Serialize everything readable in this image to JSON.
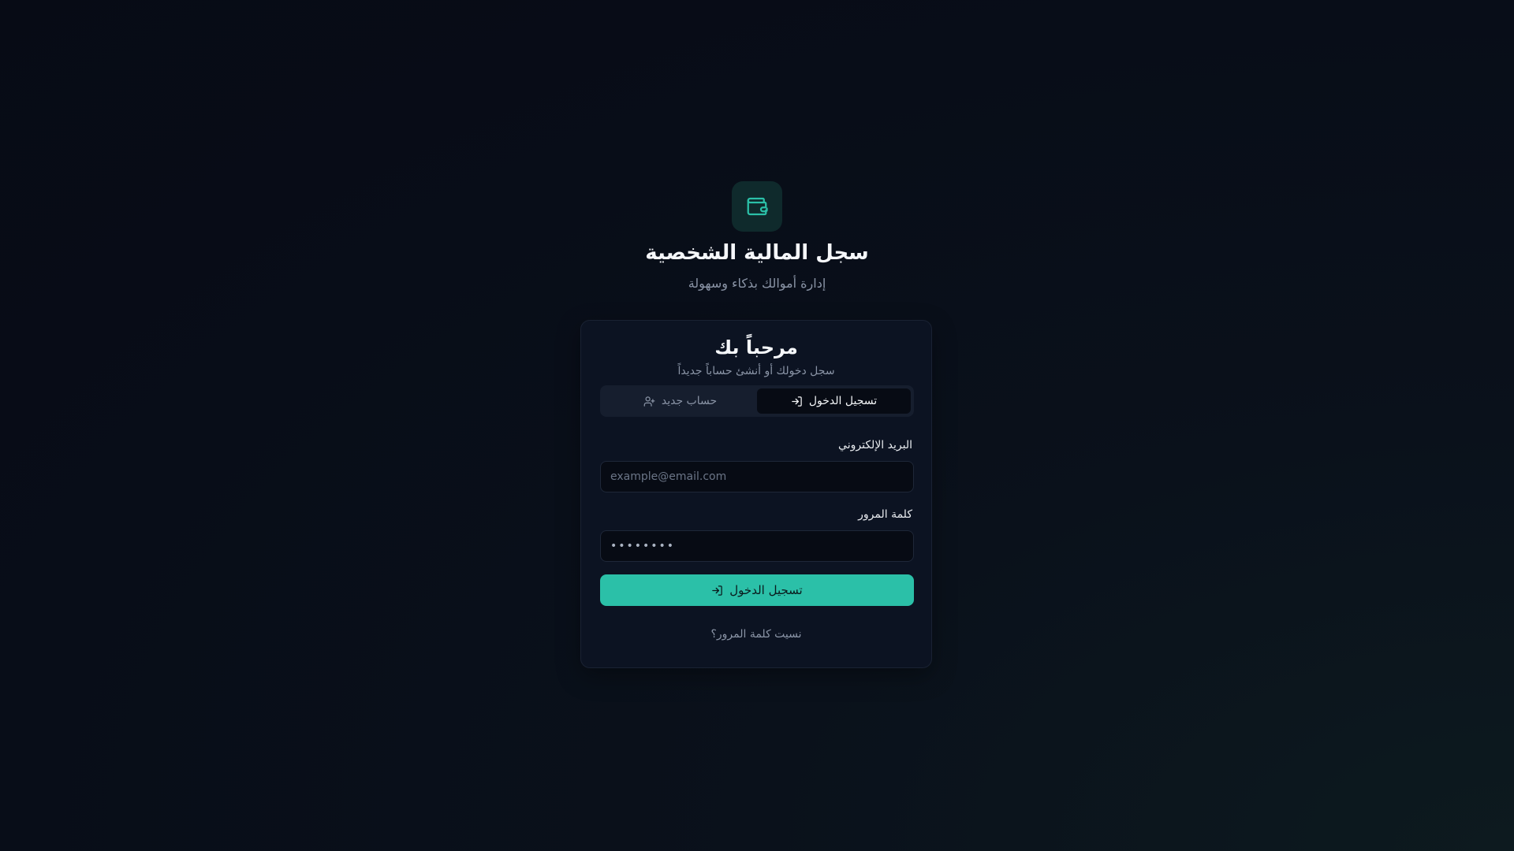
{
  "app": {
    "title": "سجل المالية الشخصية",
    "subtitle": "إدارة أموالك بذكاء وسهولة",
    "logo_icon": "wallet-icon",
    "accent_color": "#2bc0a8"
  },
  "card": {
    "title": "مرحباً بك",
    "subtitle": "سجل دخولك أو أنشئ حساباً جديداً"
  },
  "tabs": [
    {
      "label": "تسجيل الدخول",
      "icon": "log-in-icon",
      "active": true
    },
    {
      "label": "حساب جديد",
      "icon": "user-plus-icon",
      "active": false
    }
  ],
  "form": {
    "email_label": "البريد الإلكتروني",
    "email_placeholder": "example@email.com",
    "password_label": "كلمة المرور",
    "password_value": "password",
    "submit_label": "تسجيل الدخول",
    "submit_icon": "log-in-icon",
    "forgot_label": "نسيت كلمة المرور؟"
  }
}
